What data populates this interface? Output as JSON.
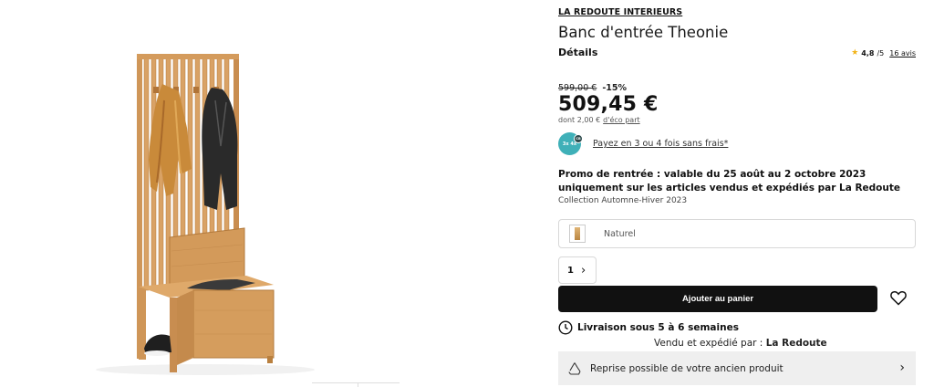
{
  "product_image": {
    "alt_icon": "entry-bench-with-coat-rack"
  },
  "brand": "LA REDOUTE INTERIEURS",
  "title": "Banc d'entrée Theonie",
  "details_label": "Détails",
  "rating": {
    "score": "4,8",
    "out_of": "/5",
    "count": "16 avis",
    "star_color": "#f2b318"
  },
  "price": {
    "old": "599,00 €",
    "discount": "-15%",
    "current": "509,45 €",
    "eco_prefix": "dont 2,00 €",
    "eco_link": "d'éco part"
  },
  "payment": {
    "badge_main": "3x 4x",
    "badge_mini": "CB",
    "text": "Payez en 3 ou 4 fois sans frais*",
    "badge_color": "#3fb0b8"
  },
  "promo": "Promo de rentrée : valable du 25 août au 2 octobre 2023 uniquement sur les articles vendus et expédiés par La Redoute",
  "collection": "Collection Automne-Hiver 2023",
  "color_option": {
    "label": "Naturel"
  },
  "quantity": {
    "value": "1"
  },
  "cart_button": "Ajouter au panier",
  "delivery": {
    "text": "Livraison sous 5 à 6 semaines",
    "seller_prefix": "Vendu et expédié par :",
    "seller_name": "La Redoute"
  },
  "reprise": {
    "text": "Reprise possible de votre ancien produit"
  }
}
